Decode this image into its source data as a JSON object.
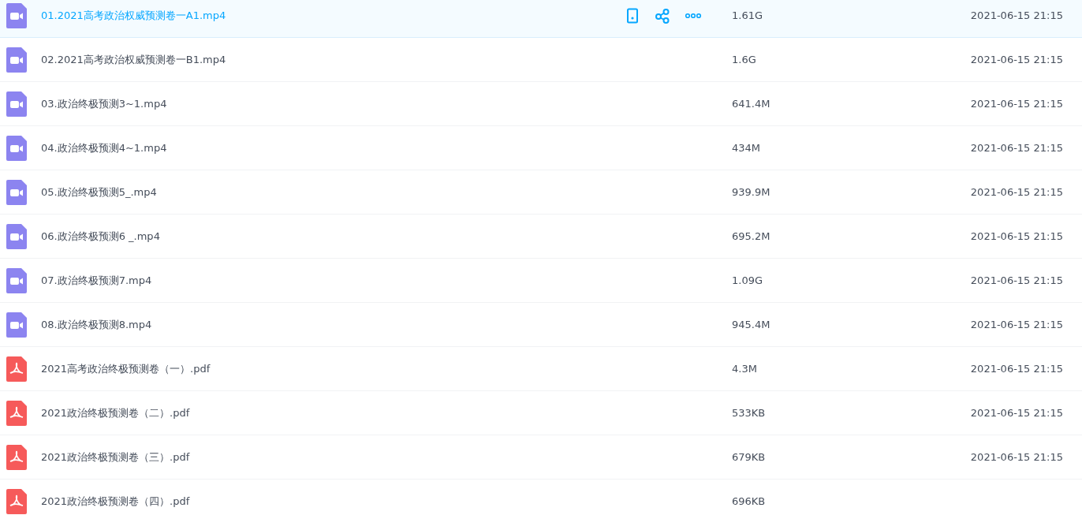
{
  "files": [
    {
      "kind": "video",
      "name": "01.2021高考政治权威预测卷一A1.mp4",
      "size": "1.61G",
      "date": "2021-06-15 21:15",
      "selected": true
    },
    {
      "kind": "video",
      "name": "02.2021高考政治权威预测卷一B1.mp4",
      "size": "1.6G",
      "date": "2021-06-15 21:15",
      "selected": false
    },
    {
      "kind": "video",
      "name": "03.政治终极预测3~1.mp4",
      "size": "641.4M",
      "date": "2021-06-15 21:15",
      "selected": false
    },
    {
      "kind": "video",
      "name": "04.政治终极预测4~1.mp4",
      "size": "434M",
      "date": "2021-06-15 21:15",
      "selected": false
    },
    {
      "kind": "video",
      "name": "05.政治终极预测5_.mp4",
      "size": "939.9M",
      "date": "2021-06-15 21:15",
      "selected": false
    },
    {
      "kind": "video",
      "name": "06.政治终极预测6 _.mp4",
      "size": "695.2M",
      "date": "2021-06-15 21:15",
      "selected": false
    },
    {
      "kind": "video",
      "name": "07.政治终极预测7.mp4",
      "size": "1.09G",
      "date": "2021-06-15 21:15",
      "selected": false
    },
    {
      "kind": "video",
      "name": "08.政治终极预测8.mp4",
      "size": "945.4M",
      "date": "2021-06-15 21:15",
      "selected": false
    },
    {
      "kind": "pdf",
      "name": "2021高考政治终极预测卷（一）.pdf",
      "size": "4.3M",
      "date": "2021-06-15 21:15",
      "selected": false
    },
    {
      "kind": "pdf",
      "name": "2021政治终极预测卷（二）.pdf",
      "size": "533KB",
      "date": "2021-06-15 21:15",
      "selected": false
    },
    {
      "kind": "pdf",
      "name": "2021政治终极预测卷（三）.pdf",
      "size": "679KB",
      "date": "2021-06-15 21:15",
      "selected": false
    },
    {
      "kind": "pdf",
      "name": "2021政治终极预测卷（四）.pdf",
      "size": "696KB",
      "selected": false
    }
  ]
}
